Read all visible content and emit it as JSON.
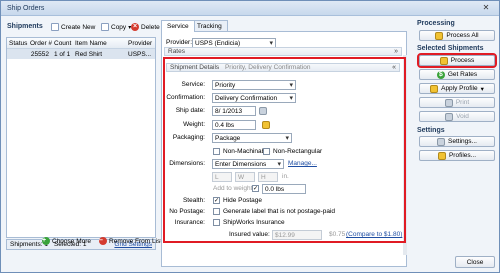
{
  "window": {
    "title": "Ship Orders"
  },
  "shipments": {
    "heading": "Shipments",
    "toolbar": {
      "create_new": "Create New",
      "copy": "Copy",
      "delete": "Delete"
    },
    "columns": [
      "Status",
      "Order #",
      "Count",
      "Item Name",
      "Provider"
    ],
    "rows": [
      {
        "status": "",
        "order": "25552",
        "count": "1 of 1",
        "item": "Red Shirt",
        "provider": "USPS..."
      }
    ],
    "footer": {
      "shipments": "Shipments: 1",
      "selected": "Selected: 1",
      "grid_settings": "Grid Settings"
    },
    "choose_more": "Choose More",
    "remove_from_list": "Remove From List"
  },
  "tabs": {
    "service": "Service",
    "tracking": "Tracking"
  },
  "provider": {
    "label": "Provider:",
    "value": "USPS (Endicia)"
  },
  "rates_label": "Rates",
  "shipment_details": {
    "header": "Shipment Details",
    "summary": "Priority, Delivery Confirmation",
    "service_label": "Service:",
    "service_value": "Priority",
    "confirmation_label": "Confirmation:",
    "confirmation_value": "Delivery Confirmation",
    "ship_date_label": "Ship date:",
    "ship_date_value": "8/  1/2013",
    "weight_label": "Weight:",
    "weight_value": "0.4 lbs",
    "packaging_label": "Packaging:",
    "packaging_value": "Package",
    "non_machinable": "Non-Machinable",
    "non_rectangular": "Non-Rectangular",
    "dimensions_label": "Dimensions:",
    "dimensions_value": "Enter Dimensions",
    "manage": "Manage...",
    "dim_l": "L",
    "dim_w": "W",
    "dim_h": "H",
    "dim_unit": "in.",
    "add_to_weight": "Add to weight",
    "add_weight_value": "0.0 lbs",
    "stealth_label": "Stealth:",
    "hide_postage": "Hide Postage",
    "no_postage_label": "No Postage:",
    "no_postage_text": "Generate label that is not postage-paid",
    "insurance_label": "Insurance:",
    "shipworks_insurance": "ShipWorks Insurance",
    "insured_value_label": "Insured value:",
    "insured_value": "$12.99",
    "insurance_cost": "$0.75",
    "compare": "(Compare to $1.80)"
  },
  "right_panel": {
    "processing_heading": "Processing",
    "process_all": "Process All",
    "selected_heading": "Selected Shipments",
    "process": "Process",
    "get_rates": "Get Rates",
    "apply_profile": "Apply Profile",
    "print": "Print",
    "void": "Void",
    "settings_heading": "Settings",
    "settings": "Settings...",
    "profiles": "Profiles..."
  },
  "close_label": "Close",
  "colors": {
    "highlight": "#e01b24",
    "accent": "#1e395b"
  }
}
